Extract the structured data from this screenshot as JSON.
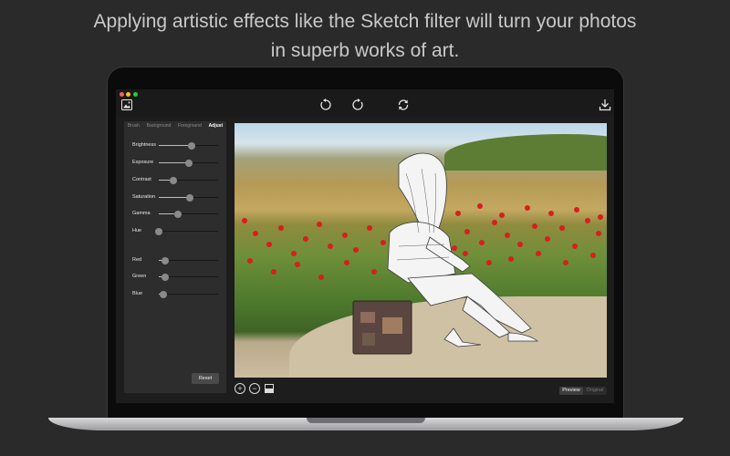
{
  "headline": {
    "line1": "Applying artistic effects like the Sketch filter will turn your photos",
    "line2": "in superb works of art."
  },
  "toolbar": {
    "left_icon": "photo-library-icon",
    "undo_icon": "rotate-left-icon",
    "redo_icon": "rotate-right-icon",
    "reset_icon": "refresh-icon",
    "export_icon": "download-icon"
  },
  "panel": {
    "tabs": [
      {
        "label": "Brush",
        "active": false
      },
      {
        "label": "Background",
        "active": false
      },
      {
        "label": "Foreground",
        "active": false
      },
      {
        "label": "Adjust",
        "active": true
      }
    ],
    "sliders": [
      {
        "label": "Brightness",
        "value": 0.55
      },
      {
        "label": "Exposure",
        "value": 0.5
      },
      {
        "label": "Contrast",
        "value": 0.24
      },
      {
        "label": "Saturation",
        "value": 0.52
      },
      {
        "label": "Gamma",
        "value": 0.32
      },
      {
        "label": "Hue",
        "value": 0.0
      },
      {
        "label": "Red",
        "value": 0.1
      },
      {
        "label": "Green",
        "value": 0.1
      },
      {
        "label": "Blue",
        "value": 0.08
      }
    ],
    "reset_label": "Reset"
  },
  "bottom": {
    "zoom_in": "+",
    "zoom_out": "−",
    "segments": [
      {
        "label": "Preview",
        "active": true
      },
      {
        "label": "Original",
        "active": false
      }
    ]
  },
  "colors": {
    "background": "#2a2a2a",
    "panel": "#2d2d2d",
    "accent_flowers": "#d81e1e"
  }
}
